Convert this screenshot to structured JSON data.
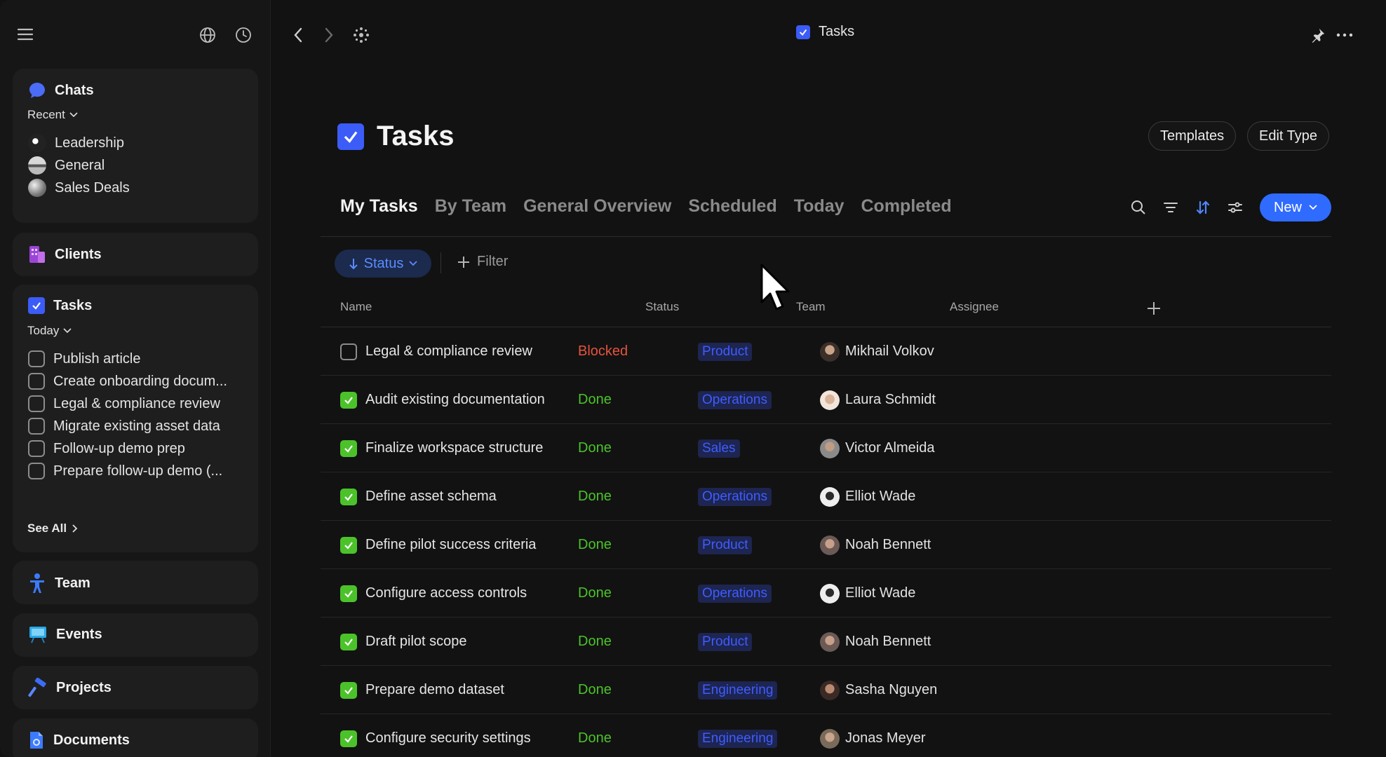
{
  "sidebar": {
    "chats": {
      "title": "Chats",
      "filter": "Recent",
      "items": [
        {
          "label": "Leadership"
        },
        {
          "label": "General"
        },
        {
          "label": "Sales Deals"
        }
      ]
    },
    "clients": {
      "title": "Clients"
    },
    "tasks": {
      "title": "Tasks",
      "filter": "Today",
      "items": [
        {
          "label": "Publish article"
        },
        {
          "label": "Create onboarding docum..."
        },
        {
          "label": "Legal & compliance review"
        },
        {
          "label": "Migrate existing asset data"
        },
        {
          "label": "Follow-up demo prep"
        },
        {
          "label": "Prepare follow-up demo (..."
        }
      ],
      "see_all": "See All"
    },
    "team": {
      "title": "Team"
    },
    "events": {
      "title": "Events"
    },
    "projects": {
      "title": "Projects"
    },
    "documents": {
      "title": "Documents"
    }
  },
  "topbar": {
    "title": "Tasks"
  },
  "page": {
    "title": "Tasks",
    "templates_label": "Templates",
    "edit_type_label": "Edit Type"
  },
  "tabs": [
    {
      "label": "My Tasks",
      "active": true
    },
    {
      "label": "By Team"
    },
    {
      "label": "General Overview"
    },
    {
      "label": "Scheduled"
    },
    {
      "label": "Today"
    },
    {
      "label": "Completed"
    }
  ],
  "toolbar": {
    "new_label": "New"
  },
  "filters": {
    "status_chip": "Status",
    "filter_label": "Filter"
  },
  "table": {
    "columns": {
      "name": "Name",
      "status": "Status",
      "team": "Team",
      "assignee": "Assignee"
    },
    "rows": [
      {
        "name": "Legal & compliance review",
        "done": false,
        "status": "Blocked",
        "team": "Product",
        "assignee": "Mikhail Volkov"
      },
      {
        "name": "Audit existing documentation",
        "done": true,
        "status": "Done",
        "team": "Operations",
        "assignee": "Laura Schmidt"
      },
      {
        "name": "Finalize workspace structure",
        "done": true,
        "status": "Done",
        "team": "Sales",
        "assignee": "Victor Almeida"
      },
      {
        "name": "Define asset schema",
        "done": true,
        "status": "Done",
        "team": "Operations",
        "assignee": "Elliot Wade"
      },
      {
        "name": "Define pilot success criteria",
        "done": true,
        "status": "Done",
        "team": "Product",
        "assignee": "Noah Bennett"
      },
      {
        "name": "Configure access controls",
        "done": true,
        "status": "Done",
        "team": "Operations",
        "assignee": "Elliot Wade"
      },
      {
        "name": "Draft pilot scope",
        "done": true,
        "status": "Done",
        "team": "Product",
        "assignee": "Noah Bennett"
      },
      {
        "name": "Prepare demo dataset",
        "done": true,
        "status": "Done",
        "team": "Engineering",
        "assignee": "Sasha Nguyen"
      },
      {
        "name": "Configure security settings",
        "done": true,
        "status": "Done",
        "team": "Engineering",
        "assignee": "Jonas Meyer"
      }
    ]
  },
  "colors": {
    "accent": "#2f6bff",
    "done": "#4cc22a",
    "blocked": "#e5533d",
    "team_badge_text": "#3f5cff"
  }
}
